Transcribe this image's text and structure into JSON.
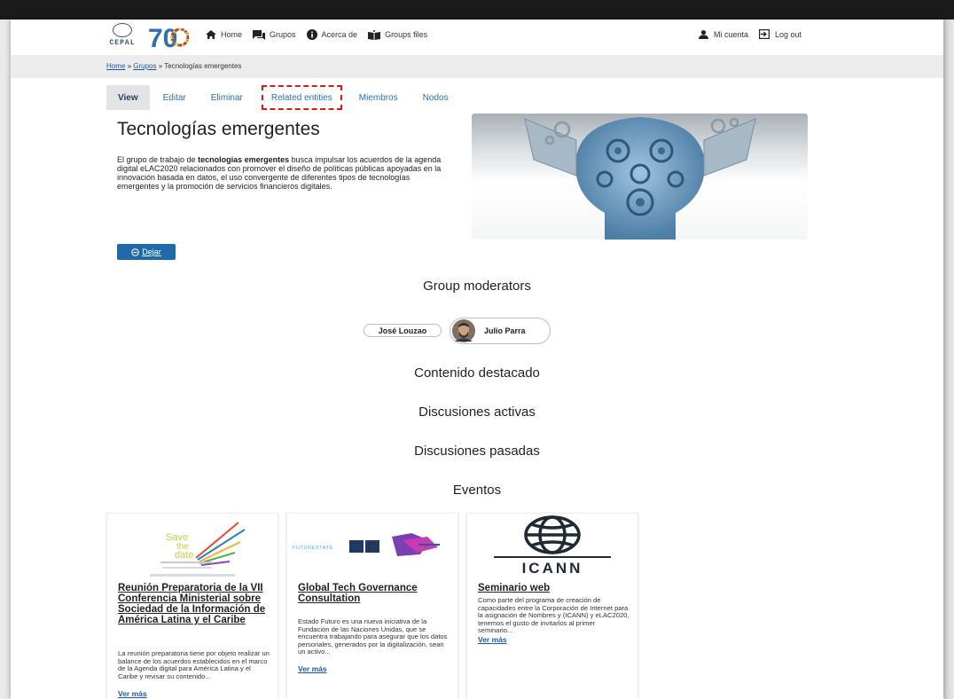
{
  "header": {
    "un_logo_text": "CEPAL",
    "logo_70_text": "70",
    "nav": [
      {
        "label": "Home",
        "icon": "home-icon"
      },
      {
        "label": "Grupos",
        "icon": "chat-icon"
      },
      {
        "label": "Acerca de",
        "icon": "info-icon"
      },
      {
        "label": "Groups files",
        "icon": "book-icon"
      }
    ],
    "account": [
      {
        "label": "Mi cuenta",
        "icon": "user-icon"
      },
      {
        "label": "Log out",
        "icon": "logout-icon"
      }
    ]
  },
  "breadcrumb": {
    "home": "Home",
    "sep": "»",
    "grupos": "Grupos",
    "current": "Tecnologías emergentes"
  },
  "tabs": [
    {
      "label": "View",
      "active": true
    },
    {
      "label": "Editar"
    },
    {
      "label": "Eliminar"
    },
    {
      "label": "Related entities",
      "highlighted": true
    },
    {
      "label": "Miembros"
    },
    {
      "label": "Nodos"
    }
  ],
  "group": {
    "title": "Tecnologías emergentes",
    "desc_pre": "El grupo de trabajo de ",
    "desc_bold": "tecnologías emergentes",
    "desc_post": " busca impulsar los acuerdos de la agenda digital eLAC2020 relacionados con promover el diseño de políticas públicas apoyadas en la innovación basada en datos, el uso convergente de diferentes tipos de tecnologías emergentes y la promoción de servicios financieros digitales.",
    "leave_label": "Dejar"
  },
  "sections": {
    "moderators": "Group moderators",
    "featured": "Contenido destacado",
    "active": "Discusiones activas",
    "past": "Discusiones pasadas",
    "events": "Eventos"
  },
  "moderators": [
    {
      "name": "José Louzao"
    },
    {
      "name": "Julio Parra"
    }
  ],
  "events": [
    {
      "thumb_text": [
        "Save",
        "the",
        "date"
      ],
      "title": "Reunión Preparatoria de la VII Conferencia Ministerial sobre Sociedad de la Información de América Latina y el Caribe",
      "text": "La reunión preparatoria tiene por objeto realizar un balance de los acuerdos establecidos en el marco de la Agenda digital para América Latina y el Caribe y revisar su contenido...",
      "more": "Ver más"
    },
    {
      "thumb_text": [
        "FUTURESTATE"
      ],
      "title": "Global Tech Governance Consultation",
      "text": "Estado Futuro es una nueva iniciativa de la Fundación de las Naciones Unidas, que se encuentra trabajando para asegurar que los datos personales, generados por la digitalización, sean un activo...",
      "more": "Ver más"
    },
    {
      "thumb_text": [
        "ICANN"
      ],
      "title": "Seminario web",
      "text": "Como parte del programa de creación de capacidades entre la Corporación de Internet para la asignación de Nombres y (ICANN) y eLAC2020, tenemos el gusto de invitarlos al primer seminario...",
      "more": "Ver más"
    }
  ],
  "colors": {
    "link": "#1a5aa6",
    "tab": "#2a6fb0",
    "button": "#1f6aa8",
    "highlight": "#e01818"
  }
}
